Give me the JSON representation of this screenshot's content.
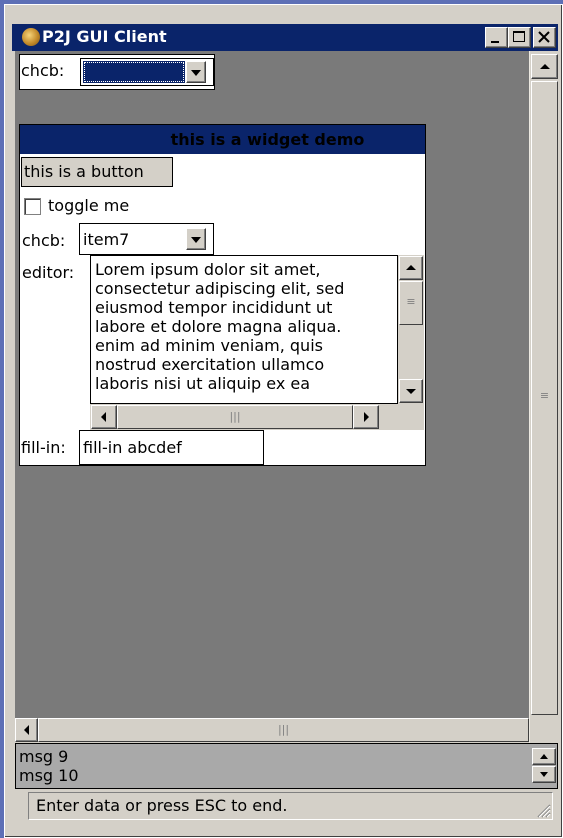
{
  "window": {
    "title": "P2J GUI Client",
    "caption_buttons": [
      "minimize-icon",
      "maximize-icon",
      "close-icon"
    ]
  },
  "top_combo": {
    "label": "chcb:",
    "value": ""
  },
  "demo": {
    "title": "this is a widget demo",
    "button_label": "this is a button",
    "toggle_label": "toggle me",
    "toggle_checked": false,
    "combo_label": "chcb:",
    "combo_value": "item7",
    "editor_label": "editor:",
    "editor_text": "Lorem ipsum dolor sit amet,\nconsectetur adipiscing elit, sed\neiusmod tempor incididunt ut\nlabore et dolore magna aliqua.\nenim ad minim veniam, quis\nnostrud exercitation ullamco\nlaboris nisi ut aliquip ex ea",
    "fillin_label": "fill-in:",
    "fillin_value": "fill-in abcdef"
  },
  "messages": [
    "msg 9",
    "msg 10"
  ],
  "status_text": "Enter data or press ESC to end.",
  "colors": {
    "titlebar": "#0a246a",
    "desktop": "#5d6fb6",
    "client": "#7a7a7a",
    "face": "#d4d0c8",
    "message_area": "#a9a9a9"
  }
}
